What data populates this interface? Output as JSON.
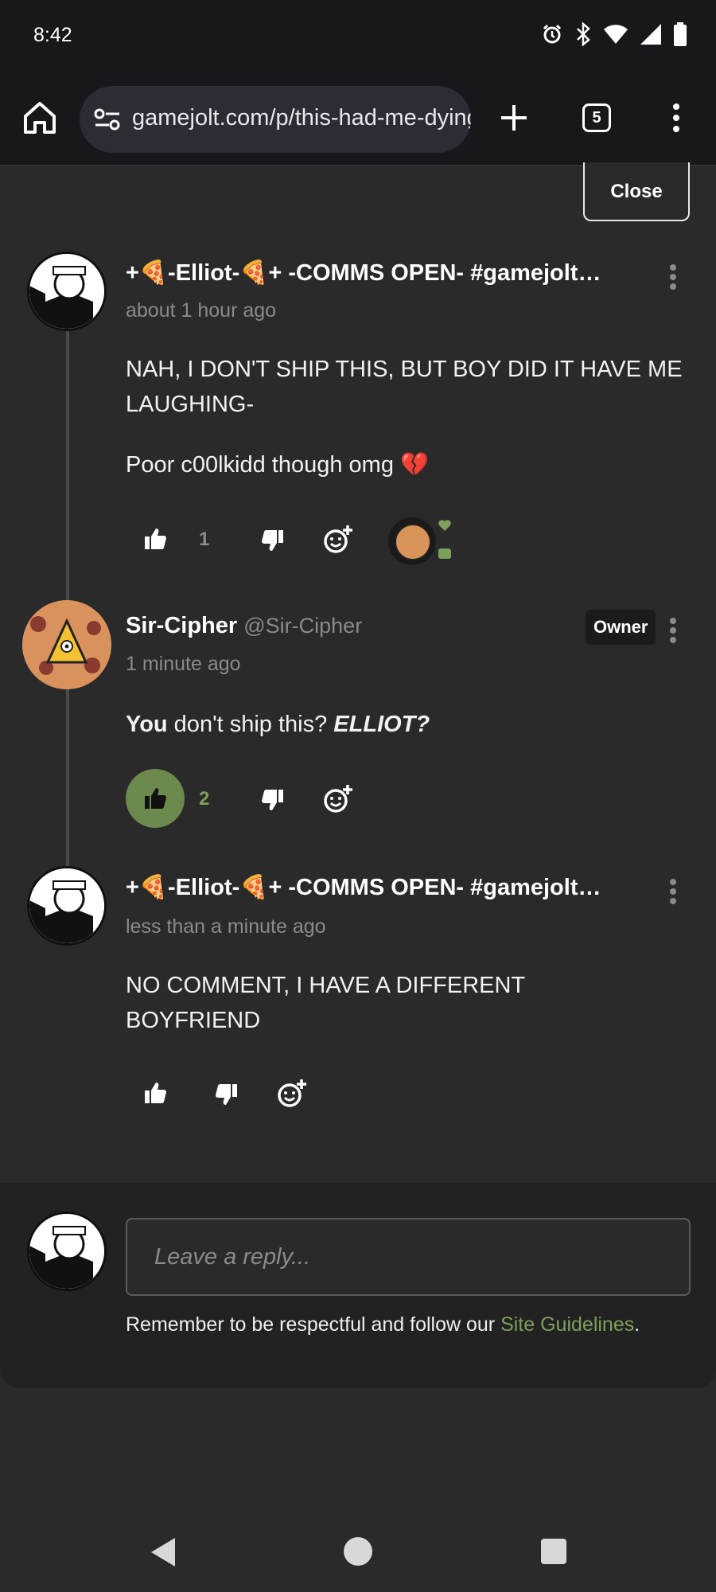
{
  "status_bar": {
    "time": "8:42"
  },
  "browser": {
    "url": "gamejolt.com/p/this-had-me-dying",
    "tab_count": "5"
  },
  "close_label": "Close",
  "comments": [
    {
      "author": "+🍕-Elliot-🍕+ -COMMS OPEN- #gamejolt…",
      "time": "about 1 hour ago",
      "paragraphs": [
        "NAH, I DON'T SHIP THIS, BUT BOY DID IT HAVE ME LAUGHING-",
        "Poor c00lkidd though omg 💔"
      ],
      "like_count": "1"
    },
    {
      "author": "Sir-Cipher",
      "handle": "@Sir-Cipher",
      "badge": "Owner",
      "time": "1 minute ago",
      "text_bold_1": "You",
      "text_mid": " don't ship this? ",
      "text_bold_2": "ELLIOT?",
      "like_count": "2"
    },
    {
      "author": "+🍕-Elliot-🍕+ -COMMS OPEN- #gamejolt…",
      "time": "less than a minute ago",
      "paragraphs": [
        "NO COMMENT, I HAVE A DIFFERENT BOYFRIEND"
      ]
    }
  ],
  "reply": {
    "placeholder": "Leave a reply...",
    "note_prefix": "Remember to be respectful and follow our ",
    "note_link": "Site Guidelines",
    "note_suffix": "."
  },
  "colors": {
    "accent": "#7ca05a",
    "like_active_bg": "#6d8a4e",
    "background": "#2a2a2b"
  }
}
